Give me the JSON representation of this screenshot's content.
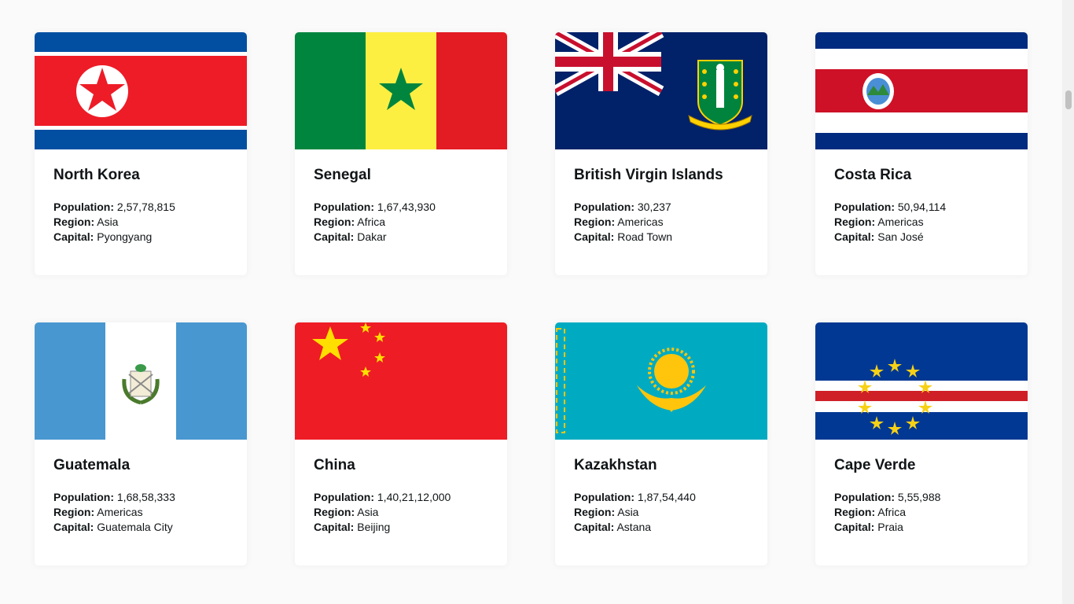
{
  "labels": {
    "population": "Population:",
    "region": "Region:",
    "capital": "Capital:"
  },
  "countries": [
    {
      "name": "North Korea",
      "population": "2,57,78,815",
      "region": "Asia",
      "capital": "Pyongyang",
      "flag": "north-korea-flag"
    },
    {
      "name": "Senegal",
      "population": "1,67,43,930",
      "region": "Africa",
      "capital": "Dakar",
      "flag": "senegal-flag"
    },
    {
      "name": "British Virgin Islands",
      "population": "30,237",
      "region": "Americas",
      "capital": "Road Town",
      "flag": "british-virgin-islands-flag"
    },
    {
      "name": "Costa Rica",
      "population": "50,94,114",
      "region": "Americas",
      "capital": "San José",
      "flag": "costa-rica-flag"
    },
    {
      "name": "Guatemala",
      "population": "1,68,58,333",
      "region": "Americas",
      "capital": "Guatemala City",
      "flag": "guatemala-flag"
    },
    {
      "name": "China",
      "population": "1,40,21,12,000",
      "region": "Asia",
      "capital": "Beijing",
      "flag": "china-flag"
    },
    {
      "name": "Kazakhstan",
      "population": "1,87,54,440",
      "region": "Asia",
      "capital": "Astana",
      "flag": "kazakhstan-flag"
    },
    {
      "name": "Cape Verde",
      "population": "5,55,988",
      "region": "Africa",
      "capital": "Praia",
      "flag": "cape-verde-flag"
    }
  ]
}
